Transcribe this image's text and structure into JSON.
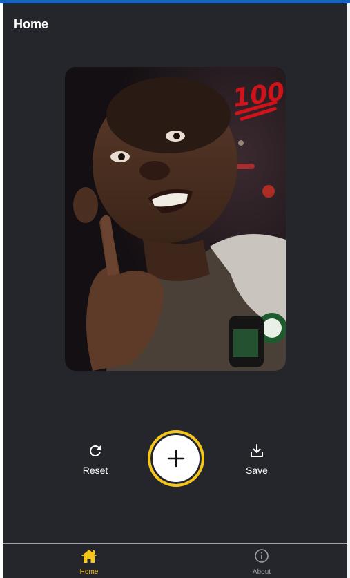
{
  "header": {
    "title": "Home"
  },
  "image": {
    "description_icon": "photo",
    "badge": "100"
  },
  "actions": {
    "reset_label": "Reset",
    "save_label": "Save",
    "add_icon": "plus-icon"
  },
  "bottom_nav": {
    "items": [
      {
        "label": "Home",
        "icon": "home-icon",
        "active": true
      },
      {
        "label": "About",
        "icon": "info-icon",
        "active": false
      }
    ]
  },
  "colors": {
    "background": "#24262b",
    "accent": "#f5c518",
    "top_bar": "#1565c0",
    "inactive": "#9aa0a6"
  }
}
